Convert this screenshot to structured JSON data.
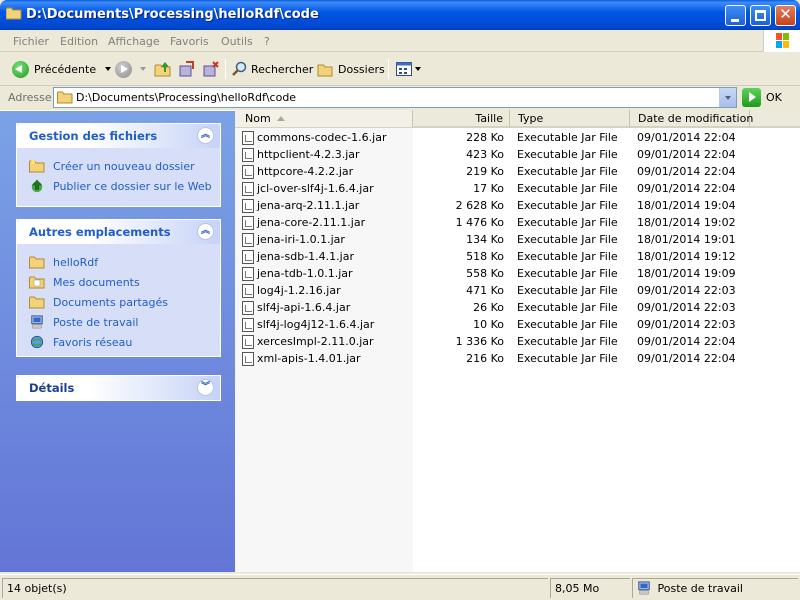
{
  "window": {
    "title": "D:\\Documents\\Processing\\helloRdf\\code"
  },
  "menu": [
    "Fichier",
    "Edition",
    "Affichage",
    "Favoris",
    "Outils",
    "?"
  ],
  "toolbar": {
    "back_label": "Précédente",
    "search_label": "Rechercher",
    "folders_label": "Dossiers"
  },
  "address": {
    "label": "Adresse",
    "value": "D:\\Documents\\Processing\\helloRdf\\code",
    "go_label": "OK"
  },
  "taskpane": {
    "file_tasks": {
      "title": "Gestion des fichiers",
      "items": [
        "Créer un nouveau dossier",
        "Publier ce dossier sur le Web"
      ]
    },
    "other_places": {
      "title": "Autres emplacements",
      "items": [
        "helloRdf",
        "Mes documents",
        "Documents partagés",
        "Poste de travail",
        "Favoris réseau"
      ]
    },
    "details": {
      "title": "Détails"
    }
  },
  "columns": {
    "name": "Nom",
    "size": "Taille",
    "type": "Type",
    "modified": "Date de modification"
  },
  "files": [
    {
      "name": "commons-codec-1.6.jar",
      "size": "228 Ko",
      "type": "Executable Jar File",
      "modified": "09/01/2014 22:04"
    },
    {
      "name": "httpclient-4.2.3.jar",
      "size": "423 Ko",
      "type": "Executable Jar File",
      "modified": "09/01/2014 22:04"
    },
    {
      "name": "httpcore-4.2.2.jar",
      "size": "219 Ko",
      "type": "Executable Jar File",
      "modified": "09/01/2014 22:04"
    },
    {
      "name": "jcl-over-slf4j-1.6.4.jar",
      "size": "17 Ko",
      "type": "Executable Jar File",
      "modified": "09/01/2014 22:04"
    },
    {
      "name": "jena-arq-2.11.1.jar",
      "size": "2 628 Ko",
      "type": "Executable Jar File",
      "modified": "18/01/2014 19:04"
    },
    {
      "name": "jena-core-2.11.1.jar",
      "size": "1 476 Ko",
      "type": "Executable Jar File",
      "modified": "18/01/2014 19:02"
    },
    {
      "name": "jena-iri-1.0.1.jar",
      "size": "134 Ko",
      "type": "Executable Jar File",
      "modified": "18/01/2014 19:01"
    },
    {
      "name": "jena-sdb-1.4.1.jar",
      "size": "518 Ko",
      "type": "Executable Jar File",
      "modified": "18/01/2014 19:12"
    },
    {
      "name": "jena-tdb-1.0.1.jar",
      "size": "558 Ko",
      "type": "Executable Jar File",
      "modified": "18/01/2014 19:09"
    },
    {
      "name": "log4j-1.2.16.jar",
      "size": "471 Ko",
      "type": "Executable Jar File",
      "modified": "09/01/2014 22:03"
    },
    {
      "name": "slf4j-api-1.6.4.jar",
      "size": "26 Ko",
      "type": "Executable Jar File",
      "modified": "09/01/2014 22:03"
    },
    {
      "name": "slf4j-log4j12-1.6.4.jar",
      "size": "10 Ko",
      "type": "Executable Jar File",
      "modified": "09/01/2014 22:03"
    },
    {
      "name": "xercesImpl-2.11.0.jar",
      "size": "1 336 Ko",
      "type": "Executable Jar File",
      "modified": "09/01/2014 22:04"
    },
    {
      "name": "xml-apis-1.4.01.jar",
      "size": "216 Ko",
      "type": "Executable Jar File",
      "modified": "09/01/2014 22:04"
    }
  ],
  "status": {
    "count": "14 objet(s)",
    "total_size": "8,05 Mo",
    "location": "Poste de travail"
  },
  "colors": {
    "titlebar": "#0055E5",
    "taskpane_top": "#7BA2E7",
    "taskpane_bottom": "#6375D6",
    "task_link": "#215DC6"
  }
}
